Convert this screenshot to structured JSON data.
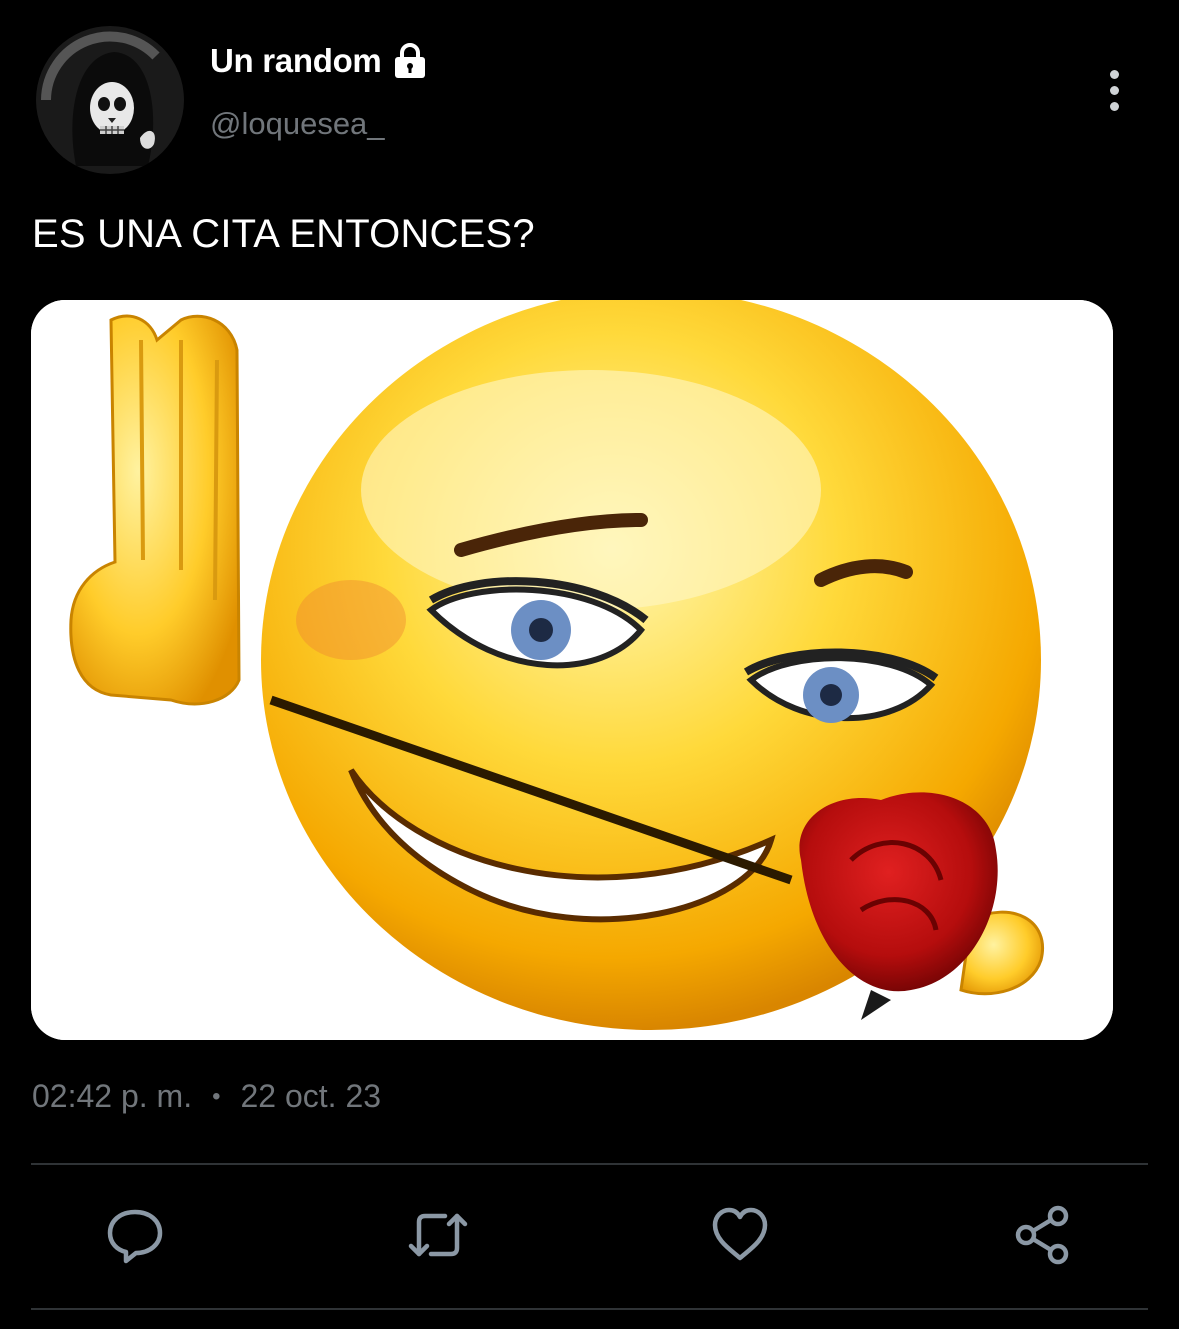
{
  "author": {
    "display_name": "Un random",
    "handle": "@loquesea_",
    "protected_icon": "lock-icon",
    "avatar_icon": "grim-reaper-avatar"
  },
  "tweet": {
    "text": "ES UNA CITA ENTONCES?",
    "media_description_icon": "flirty-emoji-with-rose-image",
    "time": "02:42 p. m.",
    "separator": "•",
    "date": "22 oct. 23"
  },
  "actions": [
    {
      "icon": "reply-icon"
    },
    {
      "icon": "retweet-icon"
    },
    {
      "icon": "like-icon"
    },
    {
      "icon": "share-icon"
    }
  ],
  "colors": {
    "background": "#000000",
    "primary_text": "#ffffff",
    "secondary_text": "#71767b",
    "divider": "#2f3336",
    "icon": "#8b98a5"
  }
}
